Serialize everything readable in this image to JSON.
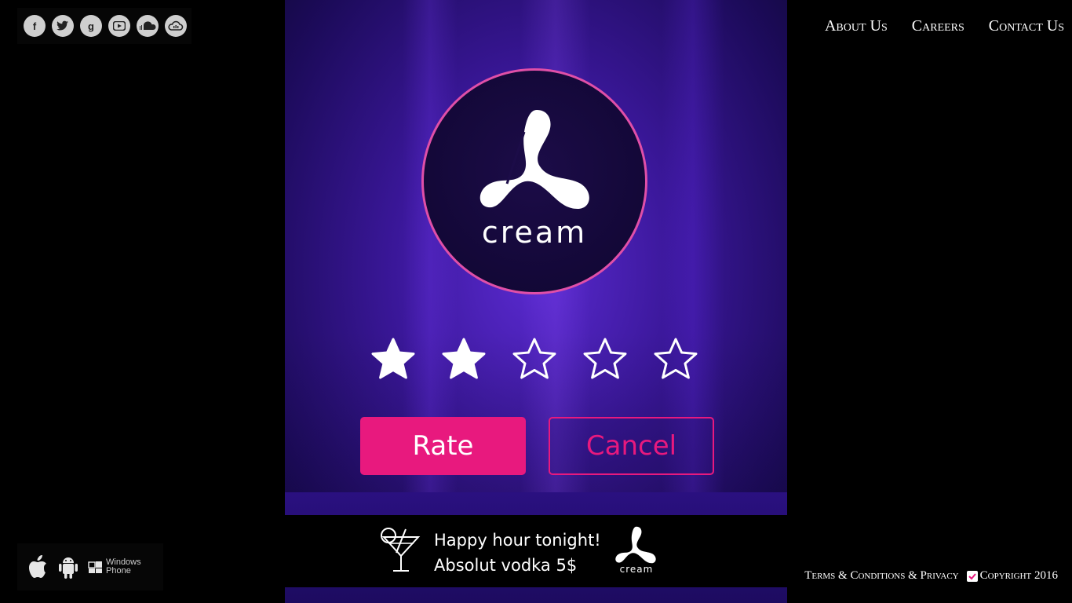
{
  "social": {
    "icons": [
      "facebook-icon",
      "twitter-icon",
      "google-icon",
      "youtube-icon",
      "soundcloud-icon",
      "cloud-audio-icon"
    ],
    "glyphs": [
      "f",
      "t",
      "g",
      "▶",
      "☁",
      "☁"
    ]
  },
  "nav": {
    "about": "About Us",
    "careers": "Careers",
    "contact": "Contact Us"
  },
  "rating": {
    "logo_text": "cream",
    "value": 2,
    "max": 5,
    "rate_label": "Rate",
    "cancel_label": "Cancel"
  },
  "banner": {
    "line1": "Happy hour tonight!",
    "line2": "Absolut vodka 5$",
    "logo_text": "cream"
  },
  "stores": {
    "windows_line1": "Windows",
    "windows_line2": "Phone"
  },
  "footer": {
    "terms": "Terms & Conditions & Privacy",
    "copyright": "Copyright 2016"
  },
  "colors": {
    "accent": "#e8197e",
    "ring": "#e04fa8",
    "panel": "#3a1799"
  }
}
